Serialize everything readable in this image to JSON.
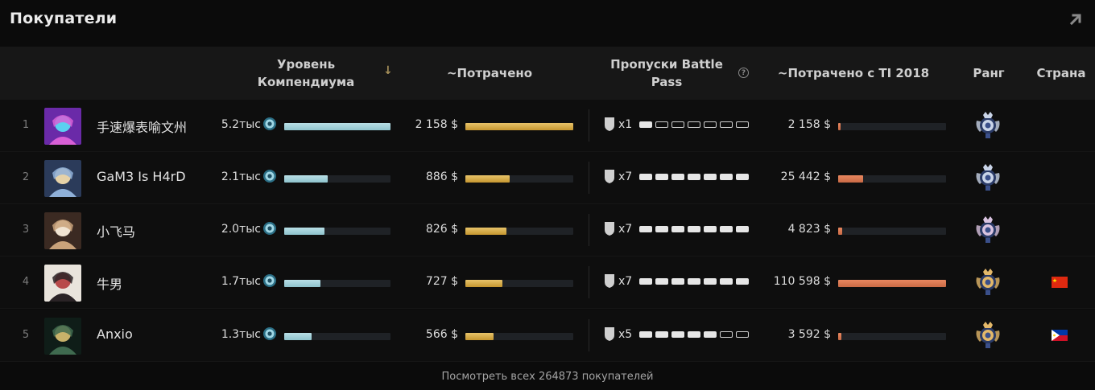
{
  "panel": {
    "title": "Покупатели",
    "expand_icon": "arrow-up-right-icon"
  },
  "columns": {
    "level": "Уровень Компендиума",
    "spent": "~Потрачено",
    "battle_pass": "Пропуски Battle Pass",
    "spent_since_ti": "~Потрачено с TI 2018",
    "rank": "Ранг",
    "country": "Страна",
    "sort_indicator": "↓",
    "help_icon": "?"
  },
  "rows": [
    {
      "rank": "1",
      "name": "手速爆表喻文州",
      "level": "5.2тыс",
      "level_fraction": 1.0,
      "spent": "2 158 $",
      "spent_fraction": 1.0,
      "bp_count": "x1",
      "bp_filled": 1,
      "bp_total": 7,
      "ti_spent": "2 158 $",
      "ti_fraction": 0.02,
      "medal_color": "#c9d4e8",
      "flag": ""
    },
    {
      "rank": "2",
      "name": "GaM3 Is H4rD",
      "level": "2.1тыс",
      "level_fraction": 0.41,
      "spent": "886 $",
      "spent_fraction": 0.41,
      "bp_count": "x7",
      "bp_filled": 7,
      "bp_total": 7,
      "ti_spent": "25 442 $",
      "ti_fraction": 0.23,
      "medal_color": "#c9d4e8",
      "flag": ""
    },
    {
      "rank": "3",
      "name": "小飞马",
      "level": "2.0тыс",
      "level_fraction": 0.38,
      "spent": "826 $",
      "spent_fraction": 0.38,
      "bp_count": "x7",
      "bp_filled": 7,
      "bp_total": 7,
      "ti_spent": "4 823 $",
      "ti_fraction": 0.04,
      "medal_color": "#d9c3e0",
      "flag": ""
    },
    {
      "rank": "4",
      "name": "牛男",
      "level": "1.7тыс",
      "level_fraction": 0.34,
      "spent": "727 $",
      "spent_fraction": 0.34,
      "bp_count": "x7",
      "bp_filled": 7,
      "bp_total": 7,
      "ti_spent": "110 598 $",
      "ti_fraction": 1.0,
      "medal_color": "#e3b86a",
      "flag": "CN"
    },
    {
      "rank": "5",
      "name": "Anxio",
      "level": "1.3тыс",
      "level_fraction": 0.26,
      "spent": "566 $",
      "spent_fraction": 0.26,
      "bp_count": "x5",
      "bp_filled": 5,
      "bp_total": 7,
      "ti_spent": "3 592 $",
      "ti_fraction": 0.03,
      "medal_color": "#e3b86a",
      "flag": "PH"
    }
  ],
  "footer": {
    "text": "Посмотреть всех 264873 покупателей"
  },
  "colors": {
    "level_bar": "#a9d3dc",
    "spent_bar": "#d9ab45",
    "ti_bar": "#dd7c55",
    "row_bg": "#0e0e0e",
    "header_bg": "#171717"
  }
}
